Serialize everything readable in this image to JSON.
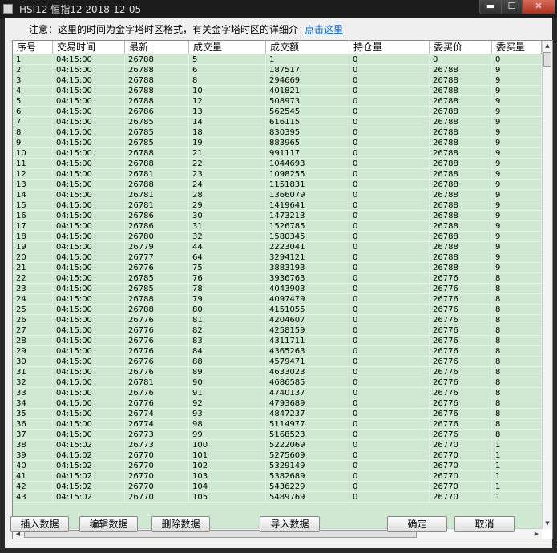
{
  "window": {
    "title": "HSI12 恒指12 2018-12-05",
    "controls": {
      "minimize": "▬",
      "maximize": "☐",
      "close": "✕"
    }
  },
  "notice": {
    "text": "注意：这里的时间为金字塔时区格式，有关金字塔时区的详细介",
    "link": "点击这里"
  },
  "table": {
    "columns": [
      "序号",
      "交易时间",
      "最新",
      "成交量",
      "成交额",
      "持仓量",
      "委买价",
      "委买量"
    ],
    "rows": [
      [
        "1",
        "04:15:00",
        "26788",
        "5",
        "1",
        "0",
        "0",
        "0"
      ],
      [
        "2",
        "04:15:00",
        "26788",
        "6",
        "187517",
        "0",
        "26788",
        "9"
      ],
      [
        "3",
        "04:15:00",
        "26788",
        "8",
        "294669",
        "0",
        "26788",
        "9"
      ],
      [
        "4",
        "04:15:00",
        "26788",
        "10",
        "401821",
        "0",
        "26788",
        "9"
      ],
      [
        "5",
        "04:15:00",
        "26788",
        "12",
        "508973",
        "0",
        "26788",
        "9"
      ],
      [
        "6",
        "04:15:00",
        "26786",
        "13",
        "562545",
        "0",
        "26788",
        "9"
      ],
      [
        "7",
        "04:15:00",
        "26785",
        "14",
        "616115",
        "0",
        "26788",
        "9"
      ],
      [
        "8",
        "04:15:00",
        "26785",
        "18",
        "830395",
        "0",
        "26788",
        "9"
      ],
      [
        "9",
        "04:15:00",
        "26785",
        "19",
        "883965",
        "0",
        "26788",
        "9"
      ],
      [
        "10",
        "04:15:00",
        "26788",
        "21",
        "991117",
        "0",
        "26788",
        "9"
      ],
      [
        "11",
        "04:15:00",
        "26788",
        "22",
        "1044693",
        "0",
        "26788",
        "9"
      ],
      [
        "12",
        "04:15:00",
        "26781",
        "23",
        "1098255",
        "0",
        "26788",
        "9"
      ],
      [
        "13",
        "04:15:00",
        "26788",
        "24",
        "1151831",
        "0",
        "26788",
        "9"
      ],
      [
        "14",
        "04:15:00",
        "26781",
        "28",
        "1366079",
        "0",
        "26788",
        "9"
      ],
      [
        "15",
        "04:15:00",
        "26781",
        "29",
        "1419641",
        "0",
        "26788",
        "9"
      ],
      [
        "16",
        "04:15:00",
        "26786",
        "30",
        "1473213",
        "0",
        "26788",
        "9"
      ],
      [
        "17",
        "04:15:00",
        "26786",
        "31",
        "1526785",
        "0",
        "26788",
        "9"
      ],
      [
        "18",
        "04:15:00",
        "26780",
        "32",
        "1580345",
        "0",
        "26788",
        "9"
      ],
      [
        "19",
        "04:15:00",
        "26779",
        "44",
        "2223041",
        "0",
        "26788",
        "9"
      ],
      [
        "20",
        "04:15:00",
        "26777",
        "64",
        "3294121",
        "0",
        "26788",
        "9"
      ],
      [
        "21",
        "04:15:00",
        "26776",
        "75",
        "3883193",
        "0",
        "26788",
        "9"
      ],
      [
        "22",
        "04:15:00",
        "26785",
        "76",
        "3936763",
        "0",
        "26776",
        "8"
      ],
      [
        "23",
        "04:15:00",
        "26785",
        "78",
        "4043903",
        "0",
        "26776",
        "8"
      ],
      [
        "24",
        "04:15:00",
        "26788",
        "79",
        "4097479",
        "0",
        "26776",
        "8"
      ],
      [
        "25",
        "04:15:00",
        "26788",
        "80",
        "4151055",
        "0",
        "26776",
        "8"
      ],
      [
        "26",
        "04:15:00",
        "26776",
        "81",
        "4204607",
        "0",
        "26776",
        "8"
      ],
      [
        "27",
        "04:15:00",
        "26776",
        "82",
        "4258159",
        "0",
        "26776",
        "8"
      ],
      [
        "28",
        "04:15:00",
        "26776",
        "83",
        "4311711",
        "0",
        "26776",
        "8"
      ],
      [
        "29",
        "04:15:00",
        "26776",
        "84",
        "4365263",
        "0",
        "26776",
        "8"
      ],
      [
        "30",
        "04:15:00",
        "26776",
        "88",
        "4579471",
        "0",
        "26776",
        "8"
      ],
      [
        "31",
        "04:15:00",
        "26776",
        "89",
        "4633023",
        "0",
        "26776",
        "8"
      ],
      [
        "32",
        "04:15:00",
        "26781",
        "90",
        "4686585",
        "0",
        "26776",
        "8"
      ],
      [
        "33",
        "04:15:00",
        "26776",
        "91",
        "4740137",
        "0",
        "26776",
        "8"
      ],
      [
        "34",
        "04:15:00",
        "26776",
        "92",
        "4793689",
        "0",
        "26776",
        "8"
      ],
      [
        "35",
        "04:15:00",
        "26774",
        "93",
        "4847237",
        "0",
        "26776",
        "8"
      ],
      [
        "36",
        "04:15:00",
        "26774",
        "98",
        "5114977",
        "0",
        "26776",
        "8"
      ],
      [
        "37",
        "04:15:00",
        "26773",
        "99",
        "5168523",
        "0",
        "26776",
        "8"
      ],
      [
        "38",
        "04:15:02",
        "26773",
        "100",
        "5222069",
        "0",
        "26770",
        "1"
      ],
      [
        "39",
        "04:15:02",
        "26770",
        "101",
        "5275609",
        "0",
        "26770",
        "1"
      ],
      [
        "40",
        "04:15:02",
        "26770",
        "102",
        "5329149",
        "0",
        "26770",
        "1"
      ],
      [
        "41",
        "04:15:02",
        "26770",
        "103",
        "5382689",
        "0",
        "26770",
        "1"
      ],
      [
        "42",
        "04:15:02",
        "26770",
        "104",
        "5436229",
        "0",
        "26770",
        "1"
      ],
      [
        "43",
        "04:15:02",
        "26770",
        "105",
        "5489769",
        "0",
        "26770",
        "1"
      ]
    ]
  },
  "buttons": {
    "insert": "插入数据",
    "edit": "编辑数据",
    "delete": "删除数据",
    "import": "导入数据",
    "ok": "确定",
    "cancel": "取消"
  },
  "icons": {
    "scroll_up": "▲",
    "scroll_down": "▼",
    "scroll_left": "◀",
    "scroll_right": "▶"
  }
}
